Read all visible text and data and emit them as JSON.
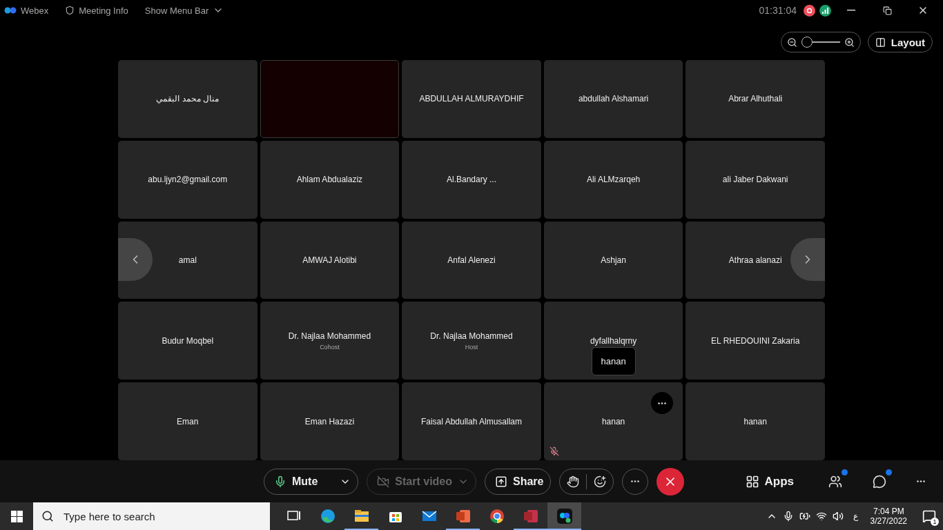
{
  "top_bar": {
    "app_name": "Webex",
    "meeting_info": "Meeting Info",
    "menu_toggle": "Show Menu Bar",
    "timer": "01:31:04"
  },
  "view_controls": {
    "zoom": {
      "level": 0
    },
    "layout_label": "Layout"
  },
  "tiles": [
    {
      "kind": "name",
      "name": "منال محمد البقمي",
      "muted": false,
      "more_button": false
    },
    {
      "kind": "video",
      "muted": false,
      "more_button": false
    },
    {
      "kind": "name",
      "name": "ABDULLAH ALMURAYDHIF",
      "muted": false,
      "more_button": false
    },
    {
      "kind": "name",
      "name": "abdullah Alshamari",
      "muted": false,
      "more_button": false
    },
    {
      "kind": "name",
      "name": "Abrar Alhuthali",
      "muted": false,
      "more_button": false
    },
    {
      "kind": "name",
      "name": "abu.ljyn2@gmail.com",
      "muted": false,
      "more_button": false
    },
    {
      "kind": "name",
      "name": "Ahlam Abdualaziz",
      "muted": false,
      "more_button": false
    },
    {
      "kind": "name",
      "name": "Al.Bandary ...",
      "muted": false,
      "more_button": false
    },
    {
      "kind": "name",
      "name": "Ali ALMzarqeh",
      "muted": false,
      "more_button": false
    },
    {
      "kind": "name",
      "name": "ali Jaber Dakwani",
      "muted": false,
      "more_button": false
    },
    {
      "kind": "name",
      "name": "amal",
      "muted": false,
      "more_button": false
    },
    {
      "kind": "name",
      "name": "AMWAJ Alotibi",
      "muted": false,
      "more_button": false
    },
    {
      "kind": "name",
      "name": "Anfal Alenezi",
      "muted": false,
      "more_button": false
    },
    {
      "kind": "name",
      "name": "Ashjan",
      "muted": false,
      "more_button": false
    },
    {
      "kind": "name",
      "name": "Athraa alanazi",
      "muted": false,
      "more_button": false
    },
    {
      "kind": "name",
      "name": "Budur Moqbel",
      "muted": false,
      "more_button": false
    },
    {
      "kind": "name",
      "name": "Dr. Najlaa Mohammed",
      "role": "Cohost",
      "muted": false,
      "more_button": false
    },
    {
      "kind": "name",
      "name": "Dr. Najlaa Mohammed",
      "role": "Host",
      "muted": false,
      "more_button": false
    },
    {
      "kind": "name",
      "name": "dyfallhalqrny",
      "tooltip": "hanan",
      "muted": false,
      "more_button": false
    },
    {
      "kind": "name",
      "name": "EL RHEDOUINI Zakaria",
      "muted": false,
      "more_button": false
    },
    {
      "kind": "name",
      "name": "Eman",
      "muted": false,
      "more_button": false
    },
    {
      "kind": "name",
      "name": "Eman Hazazi",
      "muted": false,
      "more_button": false
    },
    {
      "kind": "name",
      "name": "Faisal Abdullah Almusallam",
      "muted": false,
      "more_button": false
    },
    {
      "kind": "name",
      "name": "hanan",
      "muted": true,
      "more_button": true
    },
    {
      "kind": "name",
      "name": "hanan",
      "muted": false,
      "more_button": false
    }
  ],
  "toolbar": {
    "mute": {
      "label": "Mute",
      "disabled": false
    },
    "video": {
      "label": "Start video",
      "disabled": true
    },
    "share": {
      "label": "Share"
    },
    "apps": {
      "label": "Apps"
    },
    "participants": {
      "notify": true
    },
    "chat": {
      "notify": true
    }
  },
  "taskbar": {
    "search_placeholder": "Type here to search",
    "apps": [
      {
        "kind": "taskview",
        "running": false,
        "selected": false
      },
      {
        "kind": "edge",
        "running": false,
        "selected": false
      },
      {
        "kind": "explorer",
        "running": true,
        "selected": false
      },
      {
        "kind": "store",
        "running": false,
        "selected": false
      },
      {
        "kind": "mail",
        "running": false,
        "selected": false
      },
      {
        "kind": "powerpoint",
        "running": true,
        "selected": false
      },
      {
        "kind": "chrome",
        "running": false,
        "selected": false
      },
      {
        "kind": "access",
        "running": true,
        "selected": false
      },
      {
        "kind": "webex",
        "running": true,
        "selected": true
      }
    ],
    "language": "ع",
    "time": "7:04 PM",
    "date": "3/27/2022",
    "notification_count": "1"
  }
}
